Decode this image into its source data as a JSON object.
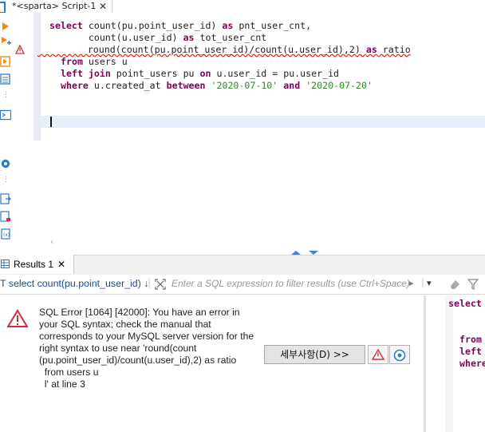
{
  "editor_tab": {
    "title": "*<sparta> Script-1",
    "close": "✕"
  },
  "code_lines": [
    [
      "select",
      " count(pu.point_user_id) ",
      "as",
      " pnt_user_cnt,"
    ],
    [
      "",
      "       count(u.user_id) ",
      "as",
      " tot_user_cnt"
    ],
    [
      "",
      "       round(count(pu.point_user_id)/count(u.user_id),2) ",
      "as",
      " ratio"
    ],
    [
      "from",
      " users u",
      "",
      ""
    ],
    [
      "left join",
      " point_users pu ",
      "on",
      " u.user_id = pu.user_id"
    ],
    [
      "where",
      " u.created_at ",
      "between",
      ""
    ]
  ],
  "where_dates": {
    "d1": "'2020-07-10'",
    "and": "and",
    "d2": "'2020-07-20'"
  },
  "results": {
    "tab_label": "Results 1",
    "close": "✕"
  },
  "filter": {
    "query_text": "T select count(pu.point_user_id) ↓",
    "placeholder": "Enter a SQL expression to filter results (use Ctrl+Space)"
  },
  "error": {
    "message": "SQL Error [1064] [42000]: You have an error in\nyour SQL syntax; check the manual that\ncorresponds to your MySQL server version for the\nright syntax to use near 'round(count\n(pu.point_user_id)/count(u.user_id),2) as ratio\n  from users u\n  l' at line 3",
    "details_button": "세부사항(D) >>"
  },
  "right_preview": {
    "line1": "select",
    "line2": "from",
    "line3": "left",
    "line4": "where"
  },
  "colors": {
    "keyword": "#7f0055",
    "string": "#2a8a2a",
    "error_red": "#d22c3a",
    "accent_blue": "#2a7ec8"
  },
  "icons": [
    "script-tab-icon",
    "run-icon",
    "run-script-icon",
    "warning-icon",
    "error-triangle-icon",
    "settings-icon",
    "results-grid-icon",
    "filter-icon",
    "info-icon"
  ]
}
